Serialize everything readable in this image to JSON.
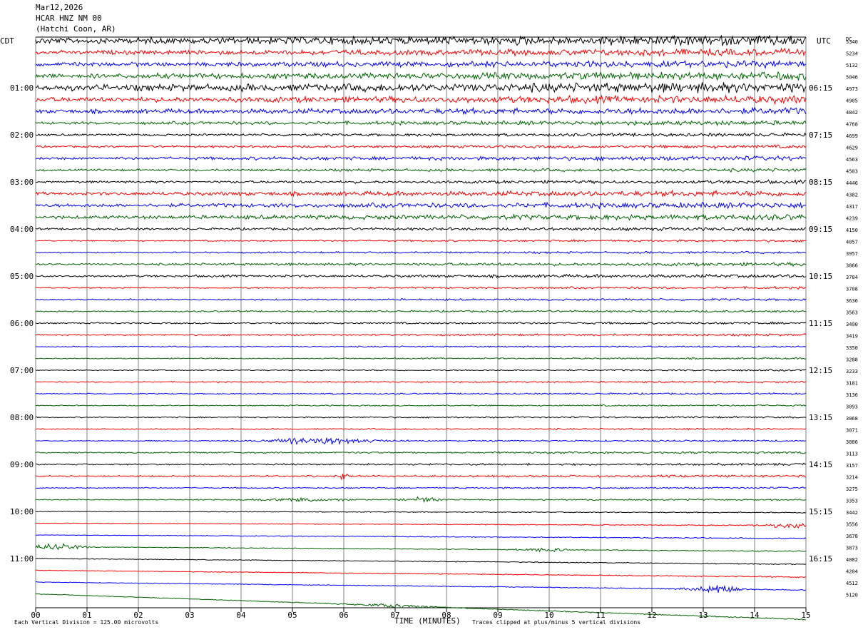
{
  "header": {
    "date": "Mar12,2026",
    "station": "HCAR HNZ NM 00",
    "location": "(Hatchi Coon, AR)"
  },
  "left_zone": "CDT",
  "right_zone": "UTC",
  "dc_label": "DC",
  "footer": {
    "scale_text": "Each Vertical Division =  125.00 microvolts",
    "clip_text": "Traces clipped at plus/minus 5 vertical divisions"
  },
  "chart_data": {
    "type": "line",
    "xlabel": "TIME (MINUTES)",
    "x_ticks": [
      "00",
      "01",
      "02",
      "03",
      "04",
      "05",
      "06",
      "07",
      "08",
      "09",
      "10",
      "11",
      "12",
      "13",
      "14",
      "15"
    ],
    "xlim": [
      0,
      15
    ],
    "vertical_grid": true,
    "trace_colors": [
      "#000000",
      "#ff0000",
      "#0000ff",
      "#006400"
    ],
    "left_hour_labels": [
      "01:00",
      "02:00",
      "03:00",
      "04:00",
      "05:00",
      "06:00",
      "07:00",
      "08:00",
      "09:00",
      "10:00",
      "11:00"
    ],
    "right_hour_labels": [
      "06:15",
      "07:15",
      "08:15",
      "09:15",
      "10:15",
      "11:15",
      "12:15",
      "13:15",
      "14:15",
      "15:15",
      "16:15"
    ],
    "dc_offsets": [
      5340,
      5234,
      5132,
      5046,
      4973,
      4905,
      4842,
      4768,
      4699,
      4629,
      4563,
      4503,
      4446,
      4382,
      4317,
      4239,
      4150,
      4057,
      3957,
      3866,
      3784,
      3708,
      3636,
      3563,
      3490,
      3419,
      3350,
      3288,
      3233,
      3181,
      3136,
      3093,
      3068,
      3071,
      3086,
      3113,
      3157,
      3214,
      3275,
      3353,
      3442,
      3556,
      3678,
      3873,
      4082,
      4204,
      4512,
      5120
    ],
    "trace_activity": [
      9,
      6,
      6,
      7,
      9,
      7,
      6,
      4,
      3,
      3,
      4,
      3,
      3,
      5,
      5,
      5,
      3,
      2,
      2,
      3,
      3,
      2,
      2,
      2,
      2,
      2,
      1.5,
      1.5,
      1.5,
      1.5,
      1.5,
      1.5,
      1.5,
      1.5,
      1.5,
      2,
      2,
      2,
      1.5,
      1.5,
      1,
      1,
      1,
      1,
      1,
      1,
      1,
      1
    ]
  }
}
